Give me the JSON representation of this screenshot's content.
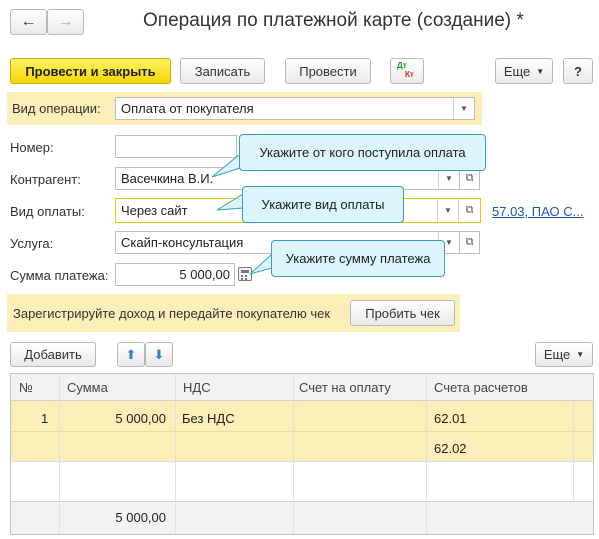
{
  "window": {
    "title": "Операция по платежной карте (создание) *",
    "nav_back": "←",
    "nav_forward": "→"
  },
  "toolbar": {
    "post_close": "Провести и закрыть",
    "save": "Записать",
    "post": "Провести",
    "dtkt_top": "Дт",
    "dtkt_bottom": "Кт",
    "more": "Еще",
    "help": "?"
  },
  "form": {
    "operation_label": "Вид операции:",
    "operation_value": "Оплата от покупателя",
    "number_label": "Номер:",
    "number_value": "",
    "contractor_label": "Контрагент:",
    "contractor_value": "Васечкина В.И.",
    "payment_type_label": "Вид оплаты:",
    "payment_type_value": "Через сайт",
    "account_link": "57.03, ПАО С...",
    "service_label": "Услуга:",
    "service_value": "Скайп-консультация",
    "amount_label": "Сумма платежа:",
    "amount_value": "5 000,00"
  },
  "tooltips": {
    "contractor": "Укажите от кого поступила оплата",
    "payment_type": "Укажите вид оплаты",
    "amount": "Укажите сумму платежа"
  },
  "receipt_bar": {
    "text": "Зарегистрируйте доход и передайте покупателю чек",
    "button": "Пробить чек"
  },
  "table_toolbar": {
    "add": "Добавить",
    "more": "Еще"
  },
  "table": {
    "columns": [
      "№",
      "Сумма",
      "НДС",
      "Счет на оплату",
      "Счета расчетов"
    ],
    "rows": [
      {
        "num": "1",
        "sum": "5 000,00",
        "vat": "Без НДС",
        "invoice": "",
        "accounts": [
          "62.01",
          "62.02"
        ]
      }
    ],
    "footer_total": "5 000,00"
  },
  "colors": {
    "accent_yellow": "#f5d800",
    "highlight_row": "#fbeeb8",
    "tooltip_bg": "#dcf5fa",
    "tooltip_border": "#3a9dc4",
    "link": "#1f5aa6"
  }
}
